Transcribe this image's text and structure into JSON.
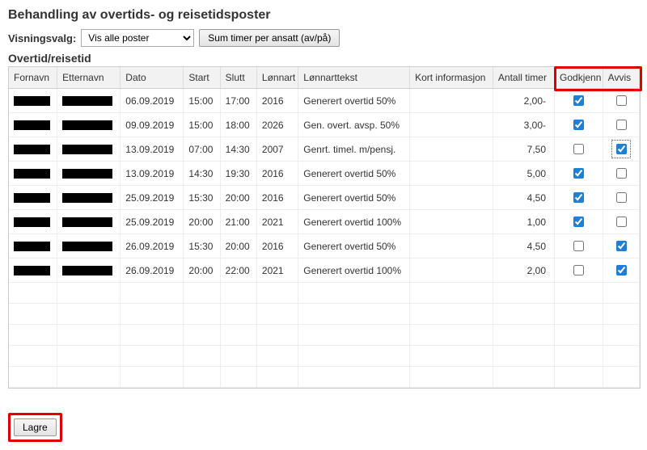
{
  "page_title": "Behandling av overtids- og reisetidsposter",
  "controls": {
    "view_label": "Visningsvalg:",
    "view_value_plain": "Vis alle poster",
    "sum_button": "Sum timer per ansatt (av/på)"
  },
  "section_title": "Overtid/reisetid",
  "columns": {
    "fornavn": "Fornavn",
    "etternavn": "Etternavn",
    "dato": "Dato",
    "start": "Start",
    "slutt": "Slutt",
    "lonnart": "Lønnart",
    "lonnarttekst": "Lønnarttekst",
    "kortinfo": "Kort informasjon",
    "antalltimer": "Antall timer",
    "godkjenn": "Godkjenn",
    "avvis": "Avvis"
  },
  "rows": [
    {
      "dato": "06.09.2019",
      "start": "15:00",
      "slutt": "17:00",
      "lonnart": "2016",
      "tekst": "Generert overtid 50%",
      "info": "",
      "timer": "2,00-",
      "godkjenn": true,
      "avvis": false,
      "avvis_focus": false
    },
    {
      "dato": "09.09.2019",
      "start": "15:00",
      "slutt": "18:00",
      "lonnart": "2026",
      "tekst": "Gen. overt. avsp. 50%",
      "info": "",
      "timer": "3,00-",
      "godkjenn": true,
      "avvis": false,
      "avvis_focus": false
    },
    {
      "dato": "13.09.2019",
      "start": "07:00",
      "slutt": "14:30",
      "lonnart": "2007",
      "tekst": "Genrt. timel. m/pensj.",
      "info": "",
      "timer": "7,50",
      "godkjenn": false,
      "avvis": true,
      "avvis_focus": true
    },
    {
      "dato": "13.09.2019",
      "start": "14:30",
      "slutt": "19:30",
      "lonnart": "2016",
      "tekst": "Generert overtid 50%",
      "info": "",
      "timer": "5,00",
      "godkjenn": true,
      "avvis": false,
      "avvis_focus": false
    },
    {
      "dato": "25.09.2019",
      "start": "15:30",
      "slutt": "20:00",
      "lonnart": "2016",
      "tekst": "Generert overtid 50%",
      "info": "",
      "timer": "4,50",
      "godkjenn": true,
      "avvis": false,
      "avvis_focus": false
    },
    {
      "dato": "25.09.2019",
      "start": "20:00",
      "slutt": "21:00",
      "lonnart": "2021",
      "tekst": "Generert overtid 100%",
      "info": "",
      "timer": "1,00",
      "godkjenn": true,
      "avvis": false,
      "avvis_focus": false
    },
    {
      "dato": "26.09.2019",
      "start": "15:30",
      "slutt": "20:00",
      "lonnart": "2016",
      "tekst": "Generert overtid 50%",
      "info": "",
      "timer": "4,50",
      "godkjenn": false,
      "avvis": true,
      "avvis_focus": false
    },
    {
      "dato": "26.09.2019",
      "start": "20:00",
      "slutt": "22:00",
      "lonnart": "2021",
      "tekst": "Generert overtid 100%",
      "info": "",
      "timer": "2,00",
      "godkjenn": false,
      "avvis": true,
      "avvis_focus": false
    }
  ],
  "empty_row_count": 5,
  "save_label": "Lagre"
}
